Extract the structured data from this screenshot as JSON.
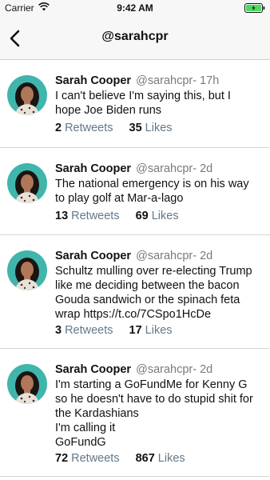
{
  "status_bar": {
    "carrier": "Carrier",
    "time": "9:42 AM"
  },
  "nav": {
    "title": "@sarahcpr"
  },
  "colors": {
    "avatar_bg": "#40b5ab",
    "link_gray": "#63788a",
    "handle_gray": "#7a7a7a"
  },
  "tweets": [
    {
      "name": "Sarah Cooper",
      "handle_time": "@sarahcpr- 17h",
      "text": "I can't believe I'm saying this, but I\nhope Joe Biden runs",
      "retweets": "2",
      "retweets_label": "Retweets",
      "likes": "35",
      "likes_label": "Likes"
    },
    {
      "name": "Sarah Cooper",
      "handle_time": "@sarahcpr- 2d",
      "text": "The national emergency is on his way\nto play golf at Mar-a-lago",
      "retweets": "13",
      "retweets_label": "Retweets",
      "likes": "69",
      "likes_label": "Likes"
    },
    {
      "name": "Sarah Cooper",
      "handle_time": "@sarahcpr- 2d",
      "text": "Schultz mulling over re-electing Trump\nlike me deciding between the bacon\nGouda sandwich or the spinach feta\nwrap https://t.co/7CSpo1HcDe",
      "retweets": "3",
      "retweets_label": "Retweets",
      "likes": "17",
      "likes_label": "Likes"
    },
    {
      "name": "Sarah Cooper",
      "handle_time": "@sarahcpr- 2d",
      "text": "I'm starting a GoFundMe for Kenny G\nso he doesn't have to do stupid shit for\nthe Kardashians\nI'm calling it\nGoFundG",
      "retweets": "72",
      "retweets_label": "Retweets",
      "likes": "867",
      "likes_label": "Likes"
    }
  ]
}
